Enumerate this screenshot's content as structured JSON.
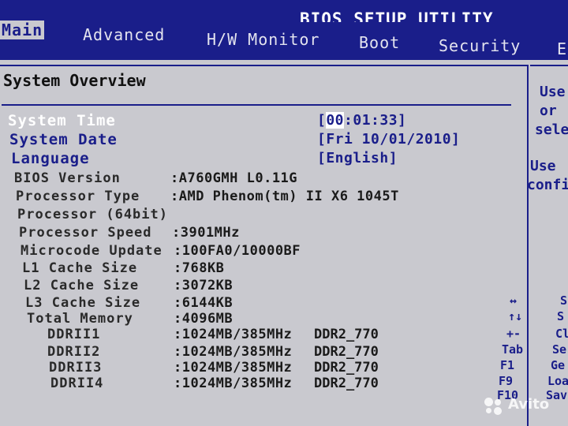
{
  "title": "BIOS SETUP UTILITY",
  "tabs": [
    {
      "label": "Main",
      "active": true
    },
    {
      "label": "Advanced",
      "active": false
    },
    {
      "label": "H/W Monitor",
      "active": false
    },
    {
      "label": "Boot",
      "active": false
    },
    {
      "label": "Security",
      "active": false
    },
    {
      "label": "E",
      "active": false
    }
  ],
  "section_title": "System Overview",
  "system_time": {
    "label": "System Time",
    "value_prefix": "[",
    "value_cursor": "00",
    "value_rest": ":01:33]"
  },
  "system_date": {
    "label": "System Date",
    "value": "[Fri 10/01/2010]"
  },
  "language": {
    "label": "Language",
    "value": "[English]"
  },
  "info_rows": [
    {
      "label": "BIOS Version",
      "value": ":A760GMH L0.11G",
      "extra": ""
    },
    {
      "label": "Processor Type",
      "value": ":AMD Phenom(tm) II X6 1045T",
      "extra": ""
    },
    {
      "label": "Processor (64bit)",
      "value": "",
      "extra": ""
    },
    {
      "label": "Processor Speed",
      "value": ":3901MHz",
      "extra": ""
    },
    {
      "label": "Microcode Update",
      "value": ":100FA0/10000BF",
      "extra": ""
    },
    {
      "label": "L1 Cache Size",
      "value": ":768KB",
      "extra": ""
    },
    {
      "label": "L2 Cache Size",
      "value": ":3072KB",
      "extra": ""
    },
    {
      "label": "L3 Cache Size",
      "value": ":6144KB",
      "extra": ""
    },
    {
      "label": "Total Memory",
      "value": ":4096MB",
      "extra": ""
    },
    {
      "label": "DDRII1",
      "value": ":1024MB/385MHz",
      "extra": "DDR2_770"
    },
    {
      "label": "DDRII2",
      "value": ":1024MB/385MHz",
      "extra": "DDR2_770"
    },
    {
      "label": "DDRII3",
      "value": ":1024MB/385MHz",
      "extra": "DDR2_770"
    },
    {
      "label": "DDRII4",
      "value": ":1024MB/385MHz",
      "extra": "DDR2_770"
    }
  ],
  "help": {
    "line1": "Use",
    "line2": "or",
    "line3": "sele",
    "line4": "Use",
    "line5": "confi"
  },
  "keys": [
    {
      "key": "↔",
      "desc": "S"
    },
    {
      "key": "↑↓",
      "desc": "S"
    },
    {
      "key": "+-",
      "desc": "Cl"
    },
    {
      "key": "Tab",
      "desc": "Se"
    },
    {
      "key": "F1",
      "desc": "Ge"
    },
    {
      "key": "F9",
      "desc": "Loa"
    },
    {
      "key": "F10",
      "desc": "Sav"
    }
  ],
  "watermark": "Avito",
  "colors": {
    "background_blue": "#1a1e8a",
    "panel_gray": "#c9c9cf",
    "highlight_white": "#ffffff"
  }
}
